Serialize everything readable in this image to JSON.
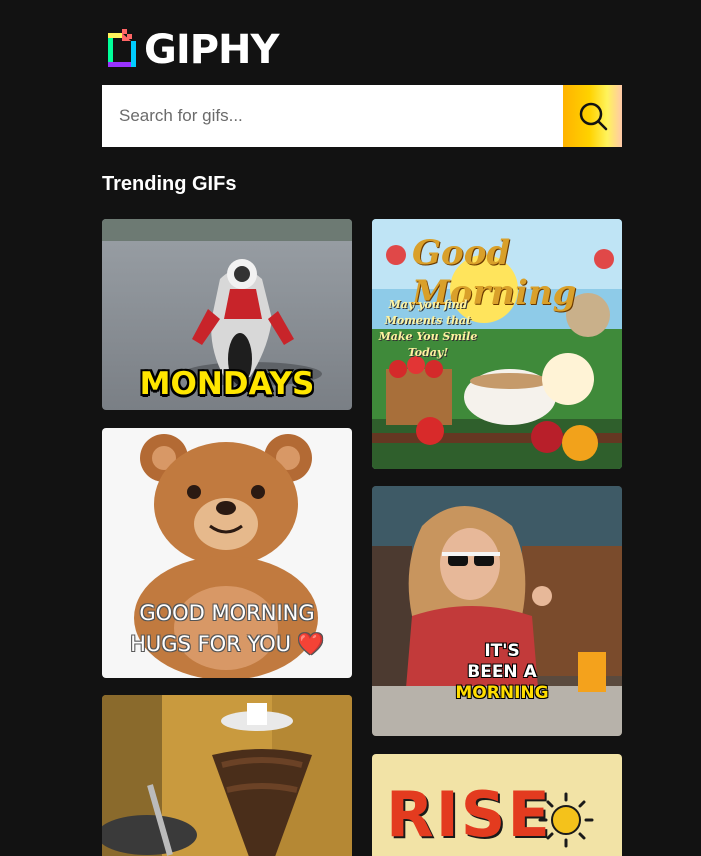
{
  "app": {
    "logo_text": "GIPHY"
  },
  "search": {
    "placeholder": "Search for gifs..."
  },
  "trending": {
    "title": "Trending GIFs",
    "gifs": [
      {
        "caption": "MONDAYS"
      },
      {
        "caption_line1": "GOOD MORNING",
        "caption_line2": "HUGS FOR YOU ❤️"
      },
      {
        "caption_line1": "IT'S",
        "caption_line2": "BEEN A",
        "caption_line3": "MORNING"
      },
      {
        "title": "Good Morning",
        "wish": "May you find Moments that Make You Smile Today!"
      },
      {
        "caption": "RISE"
      }
    ]
  },
  "colors": {
    "background": "#121212",
    "accent_yellow": "#ffd200",
    "text": "#ffffff"
  }
}
